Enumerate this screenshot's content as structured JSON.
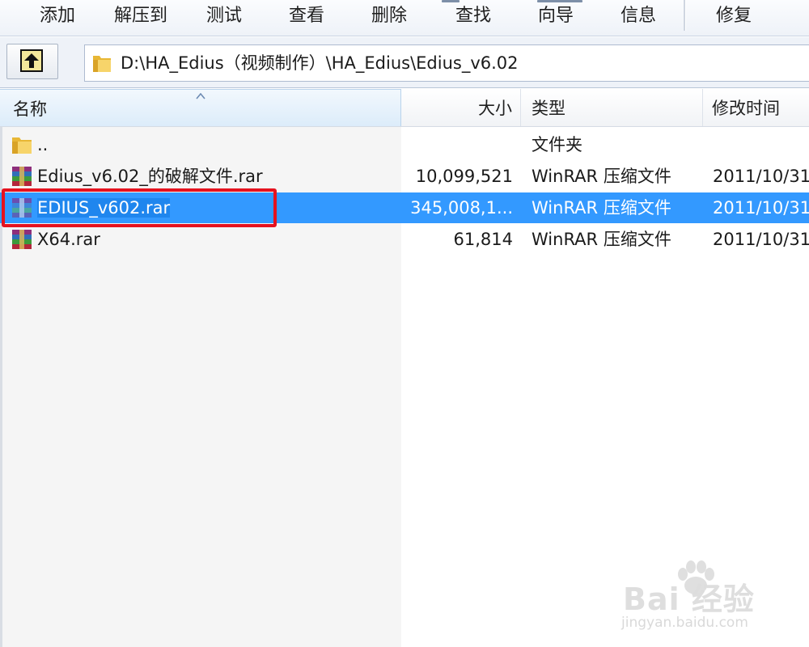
{
  "toolbar": {
    "buttons": [
      "添加",
      "解压到",
      "测试",
      "查看",
      "删除",
      "查找",
      "向导",
      "信息",
      "修复"
    ]
  },
  "address": {
    "path": "D:\\HA_Edius（视频制作）\\HA_Edius\\Edius_v6.02"
  },
  "columns": {
    "name": "名称",
    "size": "大小",
    "type": "类型",
    "modified": "修改时间"
  },
  "files": [
    {
      "name": "..",
      "size": "",
      "type": "文件夹",
      "modified": "",
      "icon": "folder-icon"
    },
    {
      "name": "Edius_v6.02_的破解文件.rar",
      "size": "10,099,521",
      "type": "WinRAR 压缩文件",
      "modified": "2011/10/31",
      "icon": "rar-archive-icon"
    },
    {
      "name": "EDIUS_v602.rar",
      "size": "345,008,1...",
      "type": "WinRAR 压缩文件",
      "modified": "2011/10/31",
      "icon": "rar-archive-icon",
      "selected": true
    },
    {
      "name": "X64.rar",
      "size": "61,814",
      "type": "WinRAR 压缩文件",
      "modified": "2011/10/31",
      "icon": "rar-archive-icon"
    }
  ],
  "watermark": {
    "brand": "Bai 经验",
    "url": "jingyan.baidu.com"
  },
  "colors": {
    "selection": "#3399ff",
    "highlight_box": "#e5121f"
  }
}
